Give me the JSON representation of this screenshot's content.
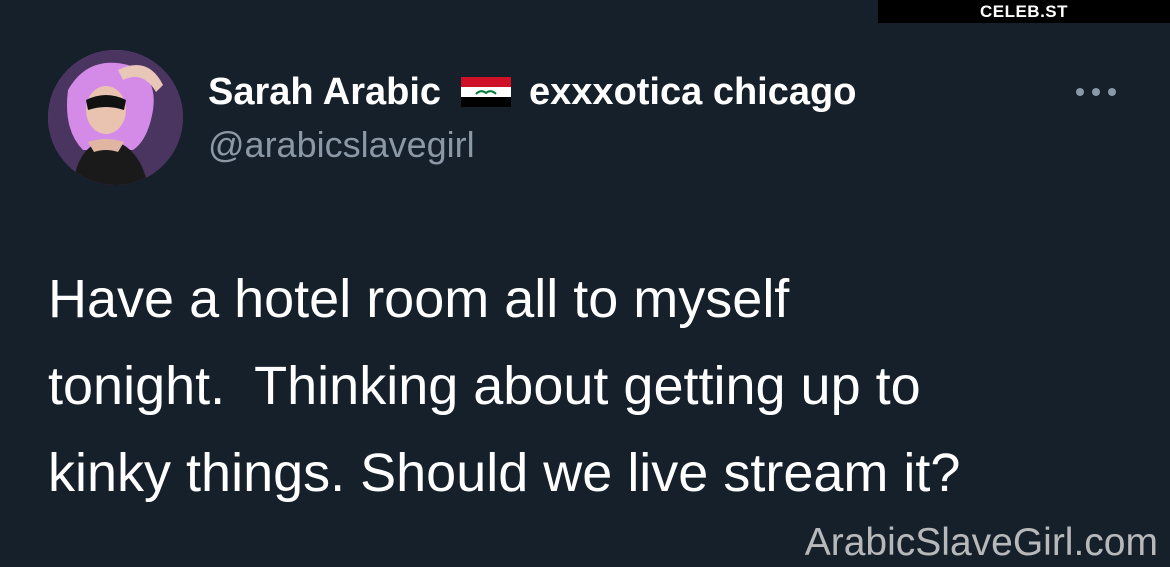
{
  "overlay": {
    "site_label": "CELEB.ST"
  },
  "tweet": {
    "author": {
      "display_name": "Sarah Arabic",
      "flag_icon": "iraq-flag-icon",
      "name_suffix": "exxxotica chicago",
      "handle": "@arabicslavegirl"
    },
    "more_icon": "more-dots-icon",
    "text_lines": [
      "Have a hotel room all to myself",
      "tonight.  Thinking about getting up to",
      "kinky things. Should we live stream it?"
    ]
  },
  "watermark": {
    "text": "ArabicSlaveGirl.com"
  },
  "colors": {
    "background": "#15202b",
    "primary_text": "#ffffff",
    "secondary_text": "#8b98a5",
    "flag_red": "#ce1126",
    "flag_white": "#ffffff",
    "flag_black": "#000000",
    "flag_green": "#007a3d"
  }
}
